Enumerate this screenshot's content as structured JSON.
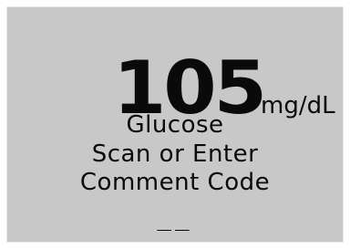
{
  "display": {
    "reading_value": "105",
    "reading_unit": "mg/dL",
    "analyte": "Glucose",
    "prompt_line_1": "Scan or Enter",
    "prompt_line_2": "Comment Code",
    "entry_field": "__"
  },
  "colors": {
    "screen_background": "#c8c8c8",
    "text": "#0a0a0a"
  }
}
